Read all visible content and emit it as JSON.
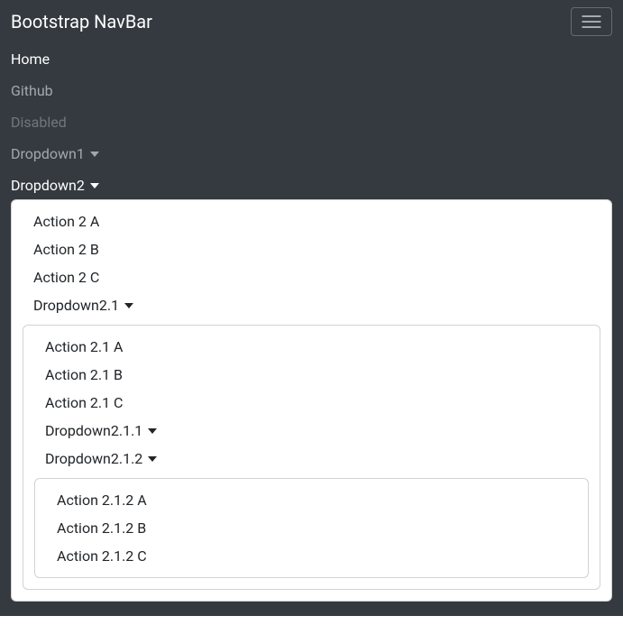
{
  "navbar": {
    "brand": "Bootstrap NavBar",
    "items": {
      "home": "Home",
      "github": "Github",
      "disabled": "Disabled",
      "dropdown1": "Dropdown1",
      "dropdown2": "Dropdown2"
    }
  },
  "dropdown2": {
    "action_a": "Action 2 A",
    "action_b": "Action 2 B",
    "action_c": "Action 2 C",
    "sub21": {
      "label": "Dropdown2.1",
      "action_a": "Action 2.1 A",
      "action_b": "Action 2.1 B",
      "action_c": "Action 2.1 C",
      "sub211": {
        "label": "Dropdown2.1.1"
      },
      "sub212": {
        "label": "Dropdown2.1.2",
        "action_a": "Action 2.1.2 A",
        "action_b": "Action 2.1.2 B",
        "action_c": "Action 2.1.2 C"
      }
    }
  }
}
